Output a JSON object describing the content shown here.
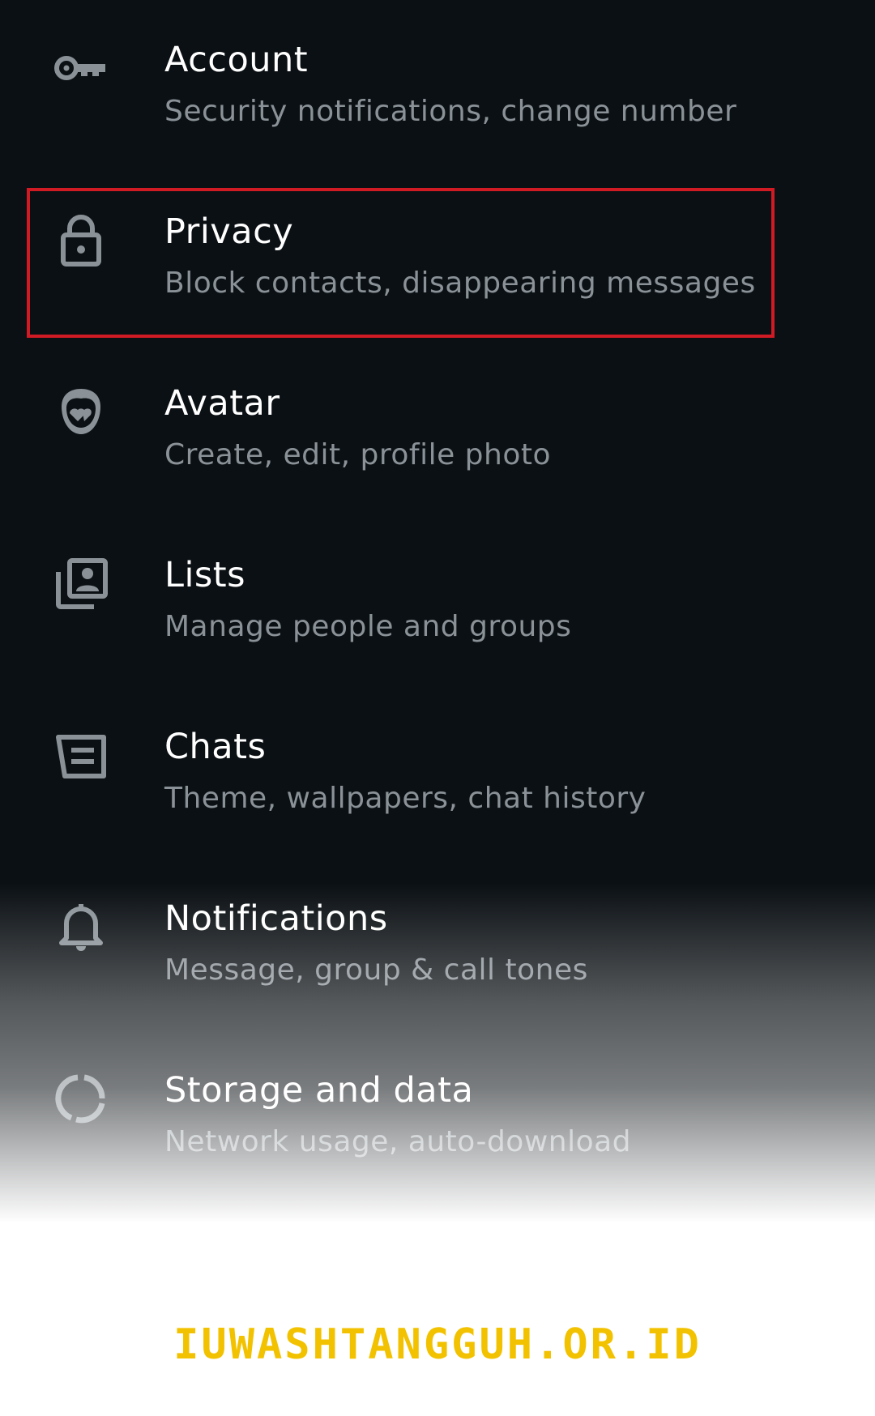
{
  "settings": {
    "items": [
      {
        "title": "Account",
        "subtitle": "Security notifications, change number",
        "icon": "key-icon"
      },
      {
        "title": "Privacy",
        "subtitle": "Block contacts, disappearing messages",
        "icon": "lock-icon",
        "highlighted": true
      },
      {
        "title": "Avatar",
        "subtitle": "Create, edit, profile photo",
        "icon": "avatar-icon"
      },
      {
        "title": "Lists",
        "subtitle": "Manage people and groups",
        "icon": "contact-list-icon"
      },
      {
        "title": "Chats",
        "subtitle": "Theme, wallpapers, chat history",
        "icon": "chat-icon"
      },
      {
        "title": "Notifications",
        "subtitle": "Message, group & call tones",
        "icon": "bell-icon"
      },
      {
        "title": "Storage and data",
        "subtitle": "Network usage, auto-download",
        "icon": "storage-icon"
      }
    ]
  },
  "colors": {
    "background": "#0b1014",
    "title": "#ffffff",
    "subtitle": "#8a9298",
    "icon": "#8a9298",
    "highlight_border": "#d01a24",
    "watermark": "#f2c200"
  },
  "watermark": {
    "text": "IUWASHTANGGUH.OR.ID"
  }
}
